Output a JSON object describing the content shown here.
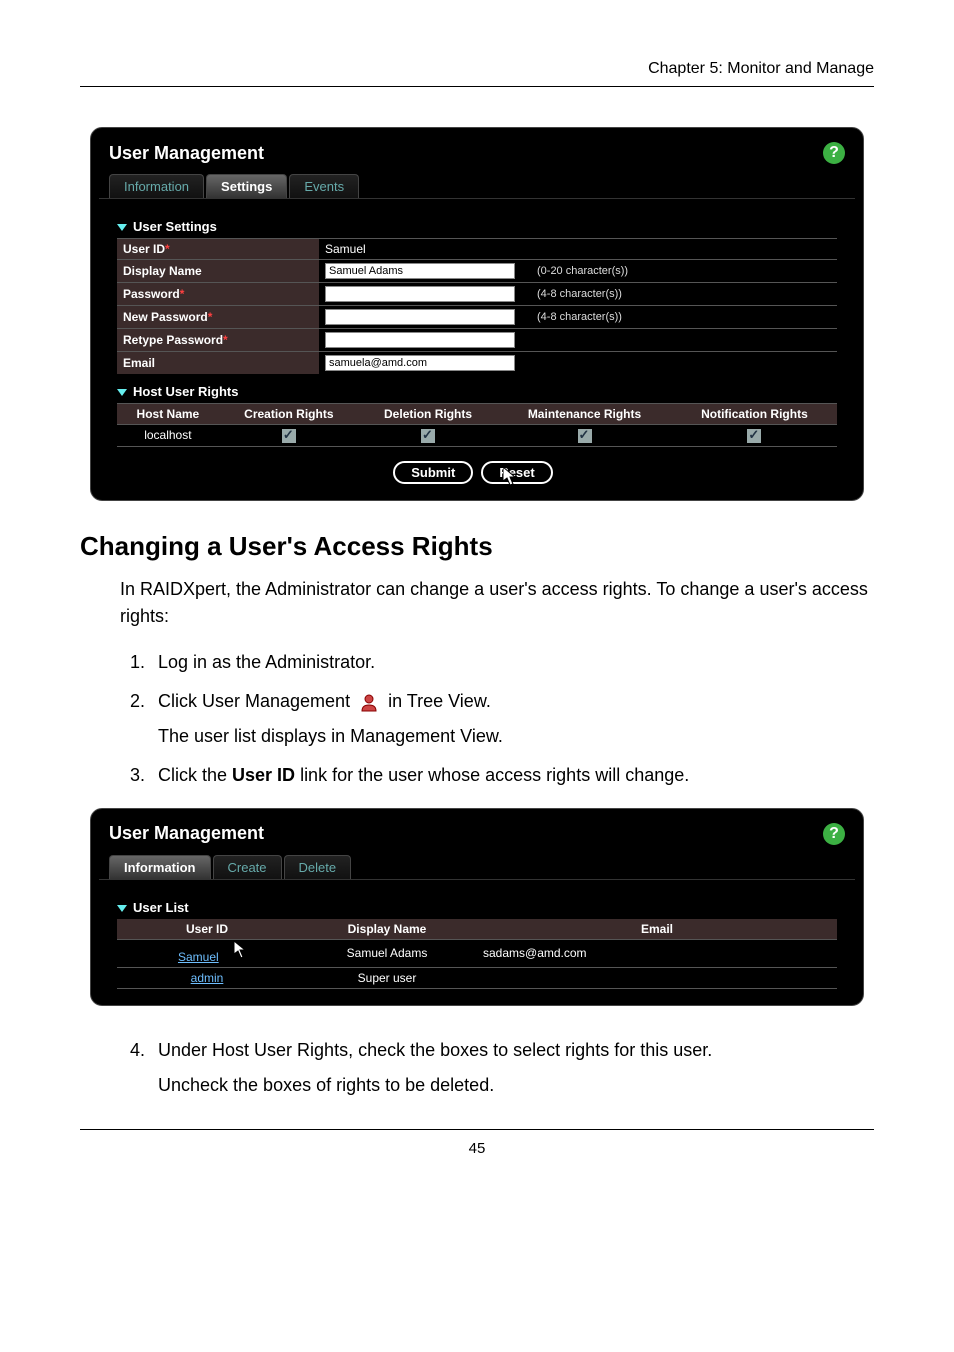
{
  "header": {
    "chapter": "Chapter 5: Monitor and Manage"
  },
  "panel1": {
    "title": "User Management",
    "help": "?",
    "tabs": {
      "info": "Information",
      "settings": "Settings",
      "events": "Events"
    },
    "user_settings_header": "User Settings",
    "fields": {
      "user_id_label": "User ID",
      "user_id_value": "Samuel",
      "display_name_label": "Display Name",
      "display_name_value": "Samuel Adams",
      "display_name_hint": "(0-20 character(s))",
      "password_label": "Password",
      "password_hint": "(4-8 character(s))",
      "new_password_label": "New Password",
      "new_password_hint": "(4-8 character(s))",
      "retype_password_label": "Retype Password",
      "email_label": "Email",
      "email_value": "samuela@amd.com"
    },
    "rights_header": "Host User Rights",
    "rights_cols": {
      "host": "Host Name",
      "creation": "Creation Rights",
      "deletion": "Deletion Rights",
      "maintenance": "Maintenance Rights",
      "notification": "Notification Rights"
    },
    "rights_row": {
      "host": "localhost"
    },
    "buttons": {
      "submit": "Submit",
      "reset": "Reset"
    }
  },
  "doc": {
    "h2": "Changing a User's Access Rights",
    "intro": "In RAIDXpert, the Administrator can change a user's access rights. To change a user's access rights:",
    "step1": "Log in as the Administrator.",
    "step2_pre": "Click User Management ",
    "step2_post": " in Tree View.",
    "step2_sub": "The user list displays in Management View.",
    "step3_a": "Click the ",
    "step3_b": "User ID",
    "step3_c": " link for the user whose access rights will change.",
    "step4_a": "Under Host User Rights, check the boxes to select rights for this user.",
    "step4_b": "Uncheck the boxes of rights to be deleted."
  },
  "panel2": {
    "title": "User Management",
    "help": "?",
    "tabs": {
      "info": "Information",
      "create": "Create",
      "delete": "Delete"
    },
    "list_header": "User List",
    "cols": {
      "user_id": "User ID",
      "display_name": "Display Name",
      "email": "Email"
    },
    "rows": {
      "r1": {
        "id": "Samuel",
        "name": "Samuel Adams",
        "email": "sadams@amd.com"
      },
      "r2": {
        "id": "admin",
        "name": "Super user",
        "email": ""
      }
    }
  },
  "footer": {
    "page": "45"
  }
}
